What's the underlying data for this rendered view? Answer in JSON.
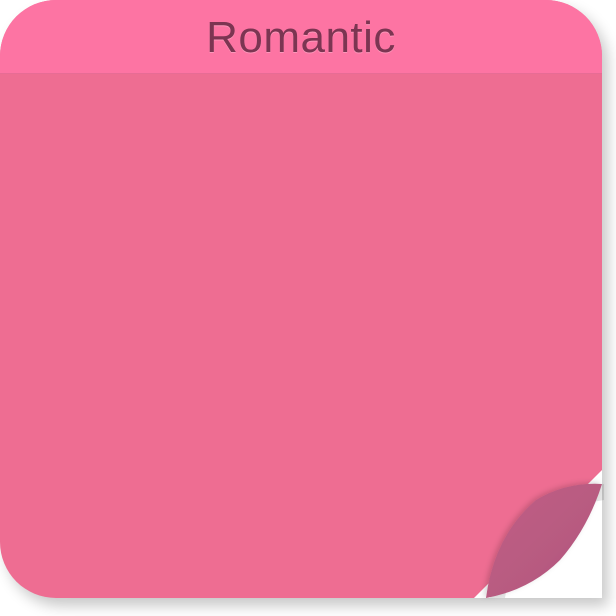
{
  "note": {
    "title": "Romantic",
    "colors": {
      "body": "#ee6d92",
      "header": "#fd74a3",
      "title_text": "#7c3552",
      "curl": "#bd5d82"
    },
    "decorations": [
      "page-curl-corner"
    ]
  }
}
